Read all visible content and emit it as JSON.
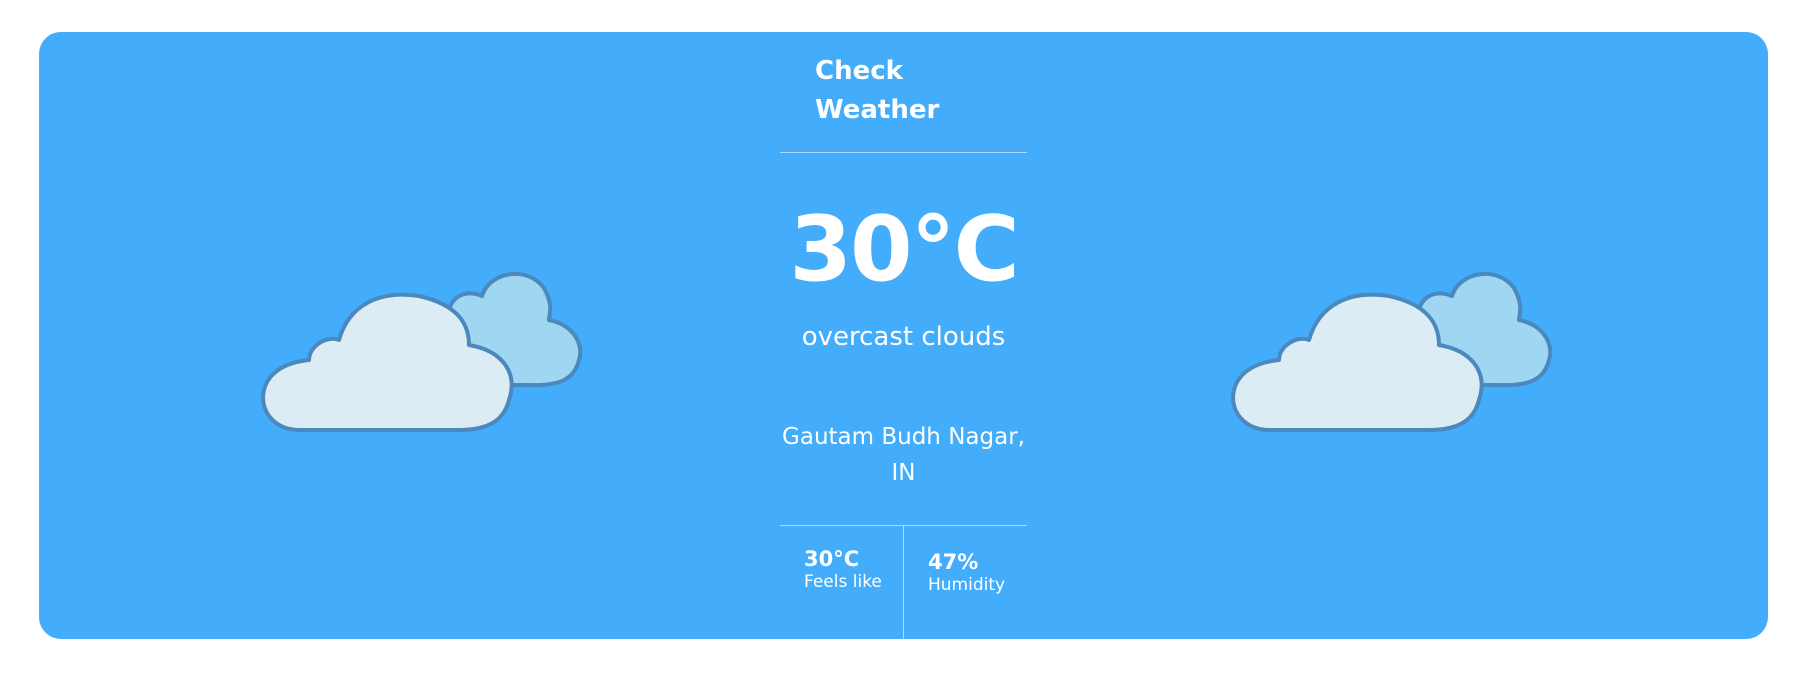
{
  "header": {
    "title": "Check Weather"
  },
  "weather": {
    "temperature": "30°C",
    "description": "overcast clouds",
    "location": "Gautam Budh Nagar, IN",
    "icon": "overcast-clouds-icon"
  },
  "stats": {
    "feels_like": {
      "value": "30°C",
      "label": "Feels like"
    },
    "humidity": {
      "value": "47%",
      "label": "Humidity"
    }
  },
  "colors": {
    "card_background": "#43adfb",
    "text": "#ffffff",
    "cloud_front_fill": "#dbecf5",
    "cloud_back_fill": "#9fd6f2",
    "cloud_outline": "#4a88bd"
  }
}
